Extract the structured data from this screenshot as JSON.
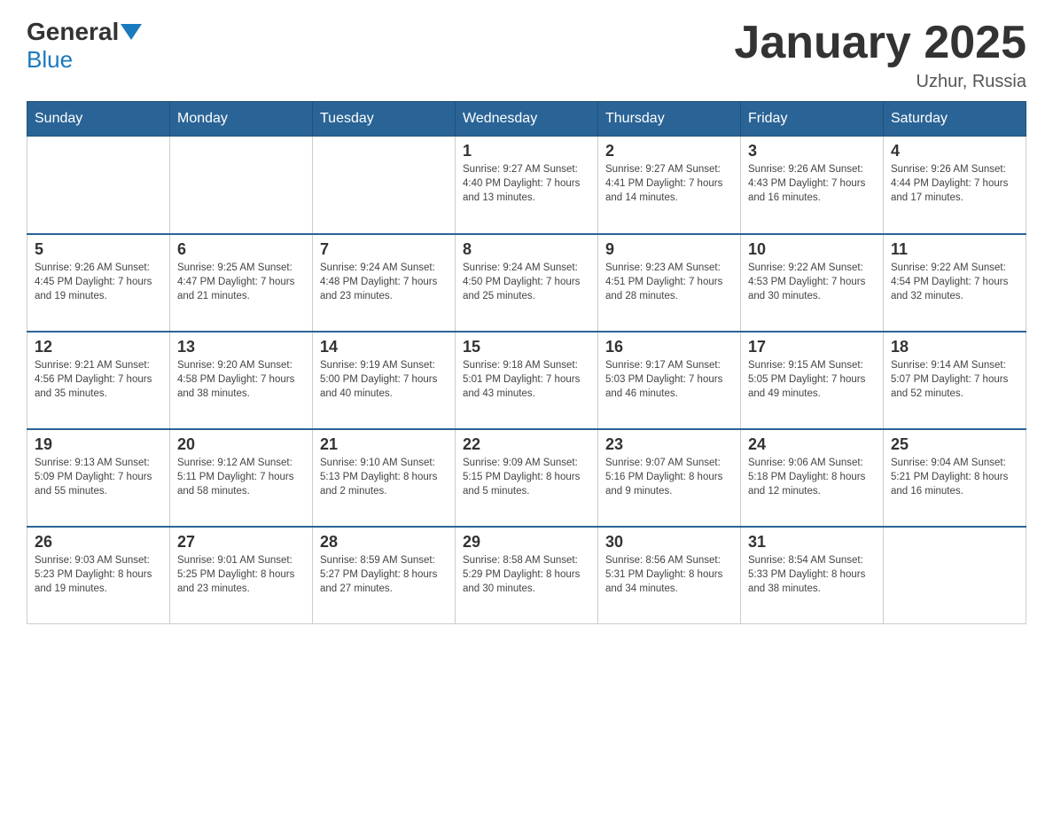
{
  "logo": {
    "general": "General",
    "blue": "Blue"
  },
  "title": "January 2025",
  "subtitle": "Uzhur, Russia",
  "days_of_week": [
    "Sunday",
    "Monday",
    "Tuesday",
    "Wednesday",
    "Thursday",
    "Friday",
    "Saturday"
  ],
  "weeks": [
    [
      {
        "day": "",
        "info": ""
      },
      {
        "day": "",
        "info": ""
      },
      {
        "day": "",
        "info": ""
      },
      {
        "day": "1",
        "info": "Sunrise: 9:27 AM\nSunset: 4:40 PM\nDaylight: 7 hours\nand 13 minutes."
      },
      {
        "day": "2",
        "info": "Sunrise: 9:27 AM\nSunset: 4:41 PM\nDaylight: 7 hours\nand 14 minutes."
      },
      {
        "day": "3",
        "info": "Sunrise: 9:26 AM\nSunset: 4:43 PM\nDaylight: 7 hours\nand 16 minutes."
      },
      {
        "day": "4",
        "info": "Sunrise: 9:26 AM\nSunset: 4:44 PM\nDaylight: 7 hours\nand 17 minutes."
      }
    ],
    [
      {
        "day": "5",
        "info": "Sunrise: 9:26 AM\nSunset: 4:45 PM\nDaylight: 7 hours\nand 19 minutes."
      },
      {
        "day": "6",
        "info": "Sunrise: 9:25 AM\nSunset: 4:47 PM\nDaylight: 7 hours\nand 21 minutes."
      },
      {
        "day": "7",
        "info": "Sunrise: 9:24 AM\nSunset: 4:48 PM\nDaylight: 7 hours\nand 23 minutes."
      },
      {
        "day": "8",
        "info": "Sunrise: 9:24 AM\nSunset: 4:50 PM\nDaylight: 7 hours\nand 25 minutes."
      },
      {
        "day": "9",
        "info": "Sunrise: 9:23 AM\nSunset: 4:51 PM\nDaylight: 7 hours\nand 28 minutes."
      },
      {
        "day": "10",
        "info": "Sunrise: 9:22 AM\nSunset: 4:53 PM\nDaylight: 7 hours\nand 30 minutes."
      },
      {
        "day": "11",
        "info": "Sunrise: 9:22 AM\nSunset: 4:54 PM\nDaylight: 7 hours\nand 32 minutes."
      }
    ],
    [
      {
        "day": "12",
        "info": "Sunrise: 9:21 AM\nSunset: 4:56 PM\nDaylight: 7 hours\nand 35 minutes."
      },
      {
        "day": "13",
        "info": "Sunrise: 9:20 AM\nSunset: 4:58 PM\nDaylight: 7 hours\nand 38 minutes."
      },
      {
        "day": "14",
        "info": "Sunrise: 9:19 AM\nSunset: 5:00 PM\nDaylight: 7 hours\nand 40 minutes."
      },
      {
        "day": "15",
        "info": "Sunrise: 9:18 AM\nSunset: 5:01 PM\nDaylight: 7 hours\nand 43 minutes."
      },
      {
        "day": "16",
        "info": "Sunrise: 9:17 AM\nSunset: 5:03 PM\nDaylight: 7 hours\nand 46 minutes."
      },
      {
        "day": "17",
        "info": "Sunrise: 9:15 AM\nSunset: 5:05 PM\nDaylight: 7 hours\nand 49 minutes."
      },
      {
        "day": "18",
        "info": "Sunrise: 9:14 AM\nSunset: 5:07 PM\nDaylight: 7 hours\nand 52 minutes."
      }
    ],
    [
      {
        "day": "19",
        "info": "Sunrise: 9:13 AM\nSunset: 5:09 PM\nDaylight: 7 hours\nand 55 minutes."
      },
      {
        "day": "20",
        "info": "Sunrise: 9:12 AM\nSunset: 5:11 PM\nDaylight: 7 hours\nand 58 minutes."
      },
      {
        "day": "21",
        "info": "Sunrise: 9:10 AM\nSunset: 5:13 PM\nDaylight: 8 hours\nand 2 minutes."
      },
      {
        "day": "22",
        "info": "Sunrise: 9:09 AM\nSunset: 5:15 PM\nDaylight: 8 hours\nand 5 minutes."
      },
      {
        "day": "23",
        "info": "Sunrise: 9:07 AM\nSunset: 5:16 PM\nDaylight: 8 hours\nand 9 minutes."
      },
      {
        "day": "24",
        "info": "Sunrise: 9:06 AM\nSunset: 5:18 PM\nDaylight: 8 hours\nand 12 minutes."
      },
      {
        "day": "25",
        "info": "Sunrise: 9:04 AM\nSunset: 5:21 PM\nDaylight: 8 hours\nand 16 minutes."
      }
    ],
    [
      {
        "day": "26",
        "info": "Sunrise: 9:03 AM\nSunset: 5:23 PM\nDaylight: 8 hours\nand 19 minutes."
      },
      {
        "day": "27",
        "info": "Sunrise: 9:01 AM\nSunset: 5:25 PM\nDaylight: 8 hours\nand 23 minutes."
      },
      {
        "day": "28",
        "info": "Sunrise: 8:59 AM\nSunset: 5:27 PM\nDaylight: 8 hours\nand 27 minutes."
      },
      {
        "day": "29",
        "info": "Sunrise: 8:58 AM\nSunset: 5:29 PM\nDaylight: 8 hours\nand 30 minutes."
      },
      {
        "day": "30",
        "info": "Sunrise: 8:56 AM\nSunset: 5:31 PM\nDaylight: 8 hours\nand 34 minutes."
      },
      {
        "day": "31",
        "info": "Sunrise: 8:54 AM\nSunset: 5:33 PM\nDaylight: 8 hours\nand 38 minutes."
      },
      {
        "day": "",
        "info": ""
      }
    ]
  ]
}
